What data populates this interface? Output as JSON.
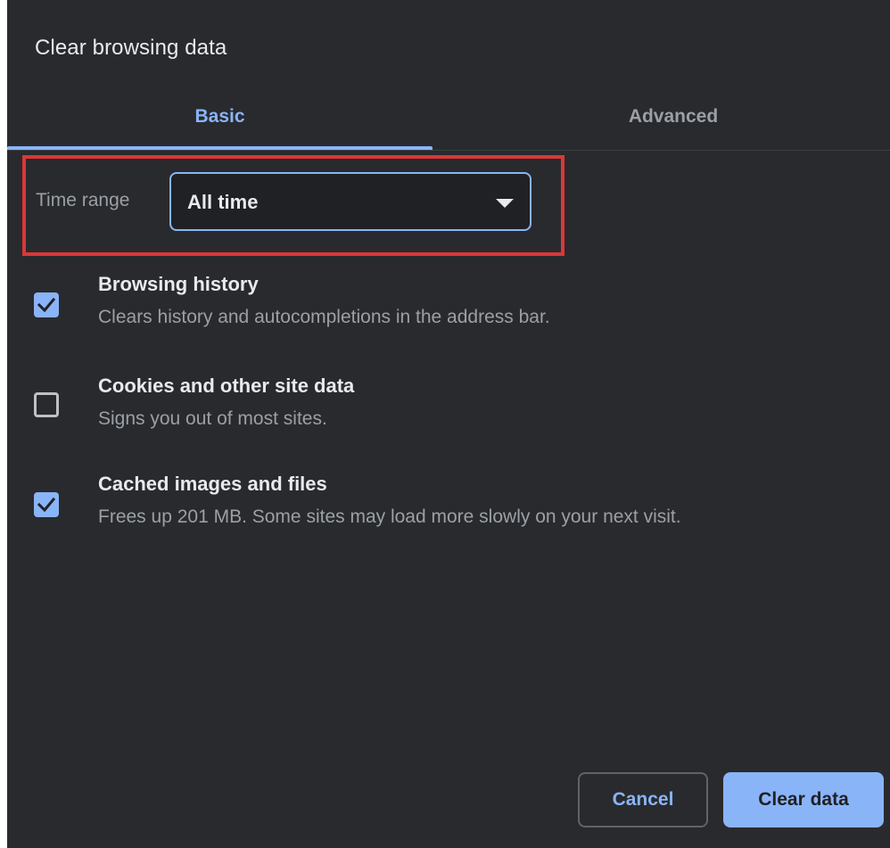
{
  "dialog": {
    "title": "Clear browsing data"
  },
  "tabs": [
    {
      "label": "Basic",
      "active": true
    },
    {
      "label": "Advanced",
      "active": false
    }
  ],
  "time_range": {
    "label": "Time range",
    "selected": "All time"
  },
  "options": [
    {
      "title": "Browsing history",
      "description": "Clears history and autocompletions in the address bar.",
      "checked": true
    },
    {
      "title": "Cookies and other site data",
      "description": "Signs you out of most sites.",
      "checked": false
    },
    {
      "title": "Cached images and files",
      "description": "Frees up 201 MB. Some sites may load more slowly on your next visit.",
      "checked": true
    }
  ],
  "buttons": {
    "cancel": "Cancel",
    "clear": "Clear data"
  },
  "colors": {
    "background": "#292a2d",
    "accent": "#8ab4f8",
    "highlight": "#d93838",
    "text_primary": "#e8eaed",
    "text_secondary": "#9aa0a6"
  },
  "icons": {
    "checked": "checkmark-icon",
    "dropdown": "dropdown-arrow-icon"
  }
}
